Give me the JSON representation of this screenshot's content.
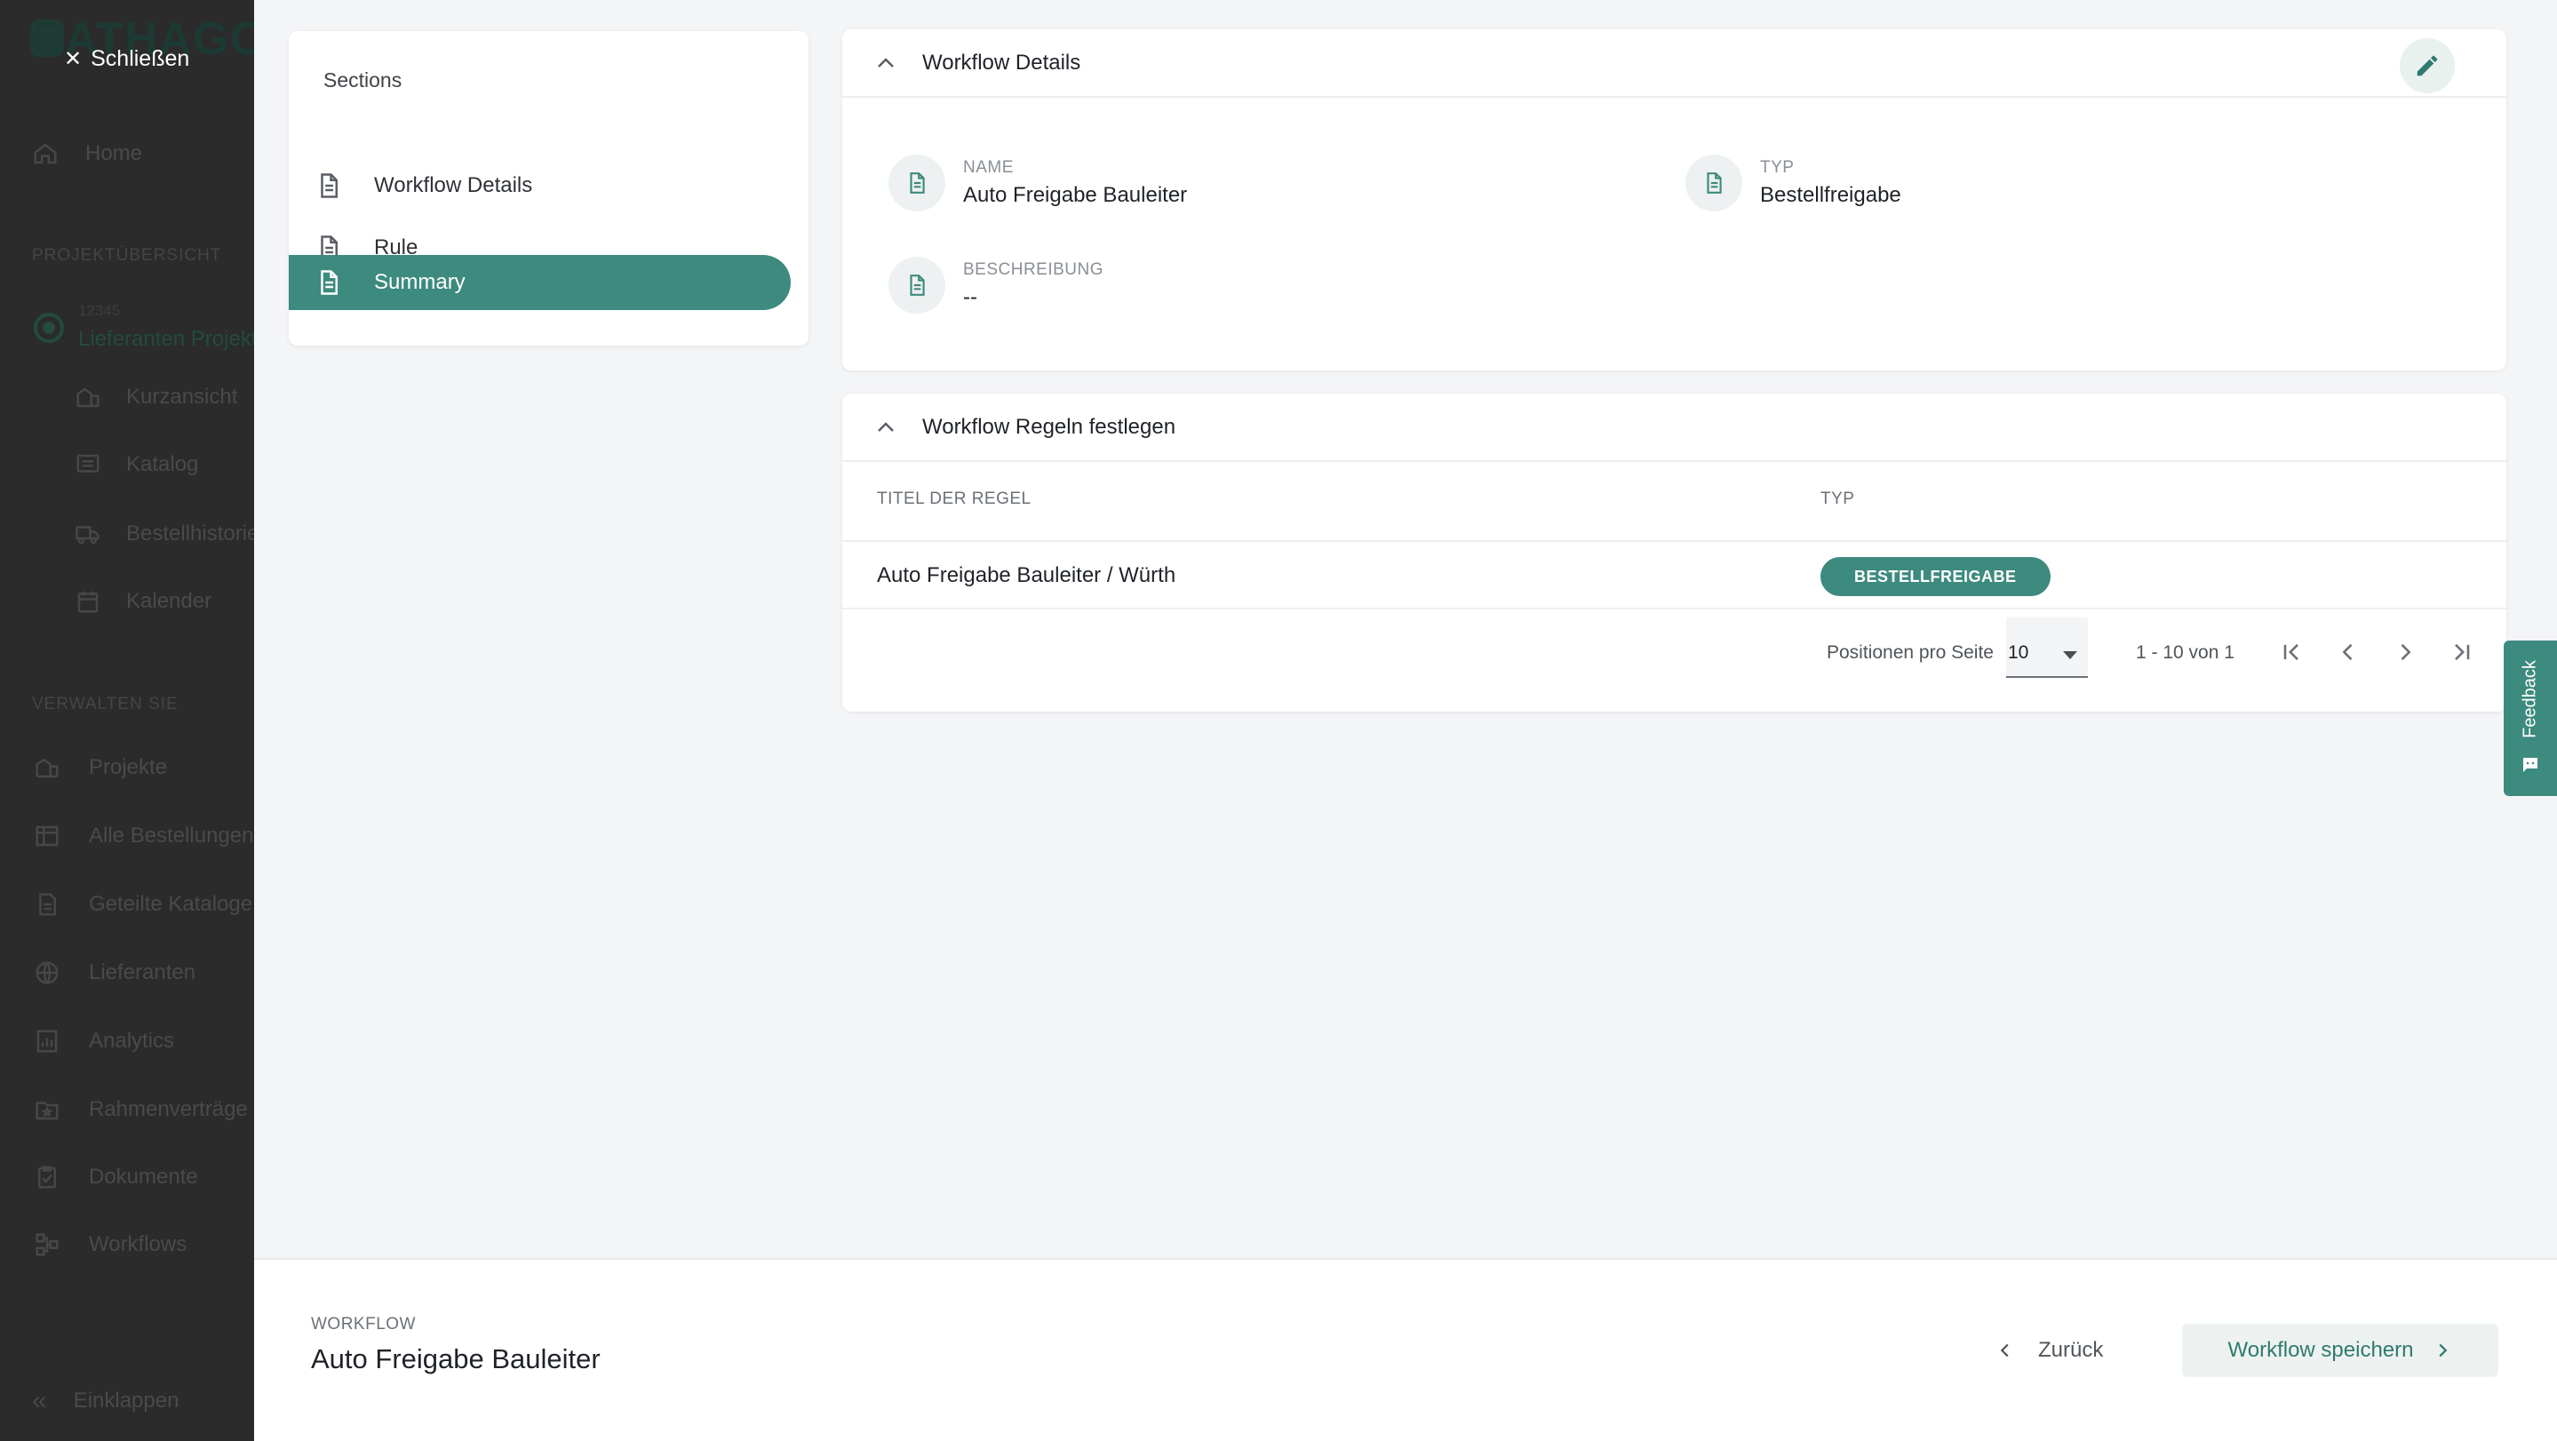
{
  "sidebar": {
    "brand": "CATHAGO",
    "close_label": "Schließen",
    "home": "Home",
    "section_projects": "PROJEKTÜBERSICHT",
    "project_number": "12345",
    "project_name": "Lieferanten Projekt",
    "project_items": [
      "Kurzansicht",
      "Katalog",
      "Bestellhistorie",
      "Kalender"
    ],
    "section_manage": "VERWALTEN SIE",
    "manage_items": [
      "Projekte",
      "Alle Bestellungen",
      "Geteilte Kataloge",
      "Lieferanten",
      "Analytics",
      "Rahmenverträge",
      "Dokumente",
      "Workflows"
    ],
    "collapse": "Einklappen"
  },
  "sections": {
    "title": "Sections",
    "items": [
      {
        "label": "Workflow Details",
        "active": false
      },
      {
        "label": "Rule",
        "active": false
      },
      {
        "label": "Summary",
        "active": true
      }
    ]
  },
  "details": {
    "header": "Workflow Details",
    "name_label": "NAME",
    "name_value": "Auto Freigabe Bauleiter",
    "type_label": "TYP",
    "type_value": "Bestellfreigabe",
    "desc_label": "BESCHREIBUNG",
    "desc_value": "--"
  },
  "rules": {
    "header": "Workflow Regeln festlegen",
    "columns": [
      "TITEL DER REGEL",
      "TYP"
    ],
    "rows": [
      {
        "title": "Auto Freigabe Bauleiter / Würth",
        "type": "BESTELLFREIGABE"
      }
    ],
    "pager": {
      "per_page_label": "Positionen pro Seite",
      "per_page_value": "10",
      "range": "1 - 10 von 1"
    }
  },
  "feedback": "Feedback",
  "footer": {
    "label": "WORKFLOW",
    "title": "Auto Freigabe Bauleiter",
    "back": "Zurück",
    "save": "Workflow speichern"
  },
  "colors": {
    "accent": "#3d8a7e",
    "overlay": "#2b2b2b"
  }
}
